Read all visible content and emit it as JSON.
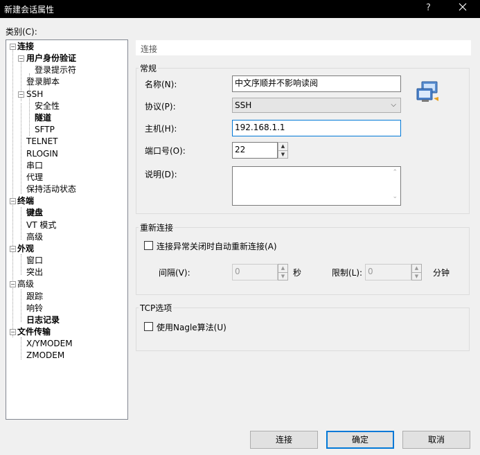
{
  "window": {
    "title": "新建会话属性",
    "help_label": "?"
  },
  "category_label": "类别(C):",
  "tree": [
    {
      "label": "连接",
      "bold": true
    },
    {
      "label": "用户身份验证",
      "bold": true
    },
    {
      "label": "登录提示符",
      "bold": false
    },
    {
      "label": "登录脚本",
      "bold": false
    },
    {
      "label": "SSH",
      "bold": false
    },
    {
      "label": "安全性",
      "bold": false
    },
    {
      "label": "隧道",
      "bold": true
    },
    {
      "label": "SFTP",
      "bold": false
    },
    {
      "label": "TELNET",
      "bold": false
    },
    {
      "label": "RLOGIN",
      "bold": false
    },
    {
      "label": "串口",
      "bold": false
    },
    {
      "label": "代理",
      "bold": false
    },
    {
      "label": "保持活动状态",
      "bold": false
    },
    {
      "label": "终端",
      "bold": true
    },
    {
      "label": "键盘",
      "bold": true
    },
    {
      "label": "VT 模式",
      "bold": false
    },
    {
      "label": "高级",
      "bold": false
    },
    {
      "label": "外观",
      "bold": true
    },
    {
      "label": "窗口",
      "bold": false
    },
    {
      "label": "突出",
      "bold": false
    },
    {
      "label": "高级",
      "bold": false
    },
    {
      "label": "跟踪",
      "bold": false
    },
    {
      "label": "响铃",
      "bold": false
    },
    {
      "label": "日志记录",
      "bold": true
    },
    {
      "label": "文件传输",
      "bold": true
    },
    {
      "label": "X/YMODEM",
      "bold": false
    },
    {
      "label": "ZMODEM",
      "bold": false
    }
  ],
  "panel": {
    "header": "连接",
    "general": {
      "title": "常规",
      "name_label": "名称(N):",
      "name_value": "中文序顺并不影响读阅",
      "protocol_label": "协议(P):",
      "protocol_value": "SSH",
      "host_label": "主机(H):",
      "host_value": "192.168.1.1",
      "port_label": "端口号(O):",
      "port_value": "22",
      "desc_label": "说明(D):",
      "desc_value": ""
    },
    "reconnect": {
      "title": "重新连接",
      "checkbox_label": "连接异常关闭时自动重新连接(A)",
      "interval_label": "间隔(V):",
      "interval_value": "0",
      "interval_unit": "秒",
      "limit_label": "限制(L):",
      "limit_value": "0",
      "limit_unit": "分钟"
    },
    "tcp": {
      "title": "TCP选项",
      "checkbox_label": "使用Nagle算法(U)"
    }
  },
  "buttons": {
    "connect": "连接",
    "ok": "确定",
    "cancel": "取消"
  }
}
